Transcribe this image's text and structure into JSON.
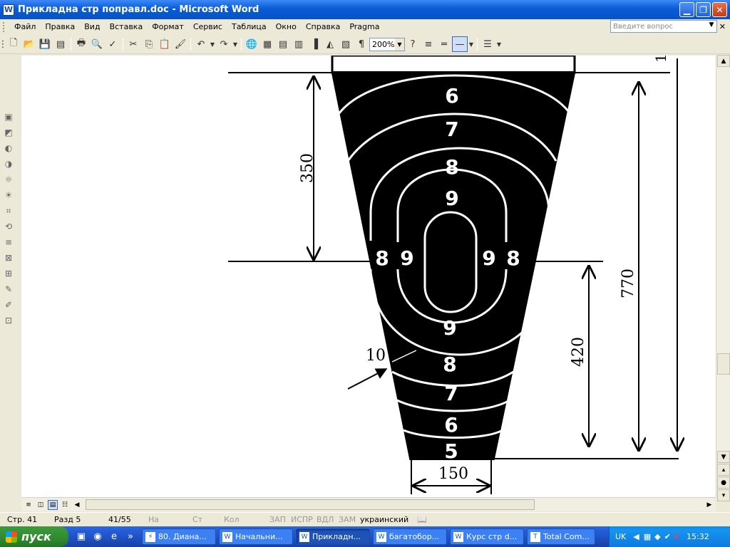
{
  "window": {
    "title": "Прикладна стр поправл.doc - Microsoft Word"
  },
  "menu": [
    "Файл",
    "Правка",
    "Вид",
    "Вставка",
    "Формат",
    "Сервис",
    "Таблица",
    "Окно",
    "Справка",
    "Pragma"
  ],
  "help_placeholder": "Введите вопрос",
  "toolbar": {
    "zoom": "200%"
  },
  "drawing": {
    "labels": {
      "dim_350": "350",
      "dim_770": "770",
      "dim_420": "420",
      "dim_150": "150",
      "label_10": "10",
      "top_partial": "1"
    },
    "rings": {
      "r6": "6",
      "r7": "7",
      "r8": "8",
      "r9": "9",
      "r8_left": "8",
      "r9_left": "9",
      "r9_right": "9",
      "r8_right": "8",
      "r9_bottom": "9",
      "r8_bottom": "8",
      "r7_bottom": "7",
      "r6_bottom": "6",
      "r5_bottom": "5"
    }
  },
  "status": {
    "page": "Стр. 41",
    "section": "Разд 5",
    "pages": "41/55",
    "at": "На",
    "line": "Ст",
    "col": "Кол",
    "rec": "ЗАП",
    "trk": "ИСПР",
    "ext": "ВДЛ",
    "ovr": "ЗАМ",
    "lang": "украинский"
  },
  "taskbar": {
    "start": "пуск",
    "tasks": [
      "80. Диана...",
      "Начальни...",
      "Прикладн...",
      "багатобор...",
      "Курс стр d...",
      "Total Com..."
    ],
    "lang": "UK",
    "time": "15:32"
  }
}
